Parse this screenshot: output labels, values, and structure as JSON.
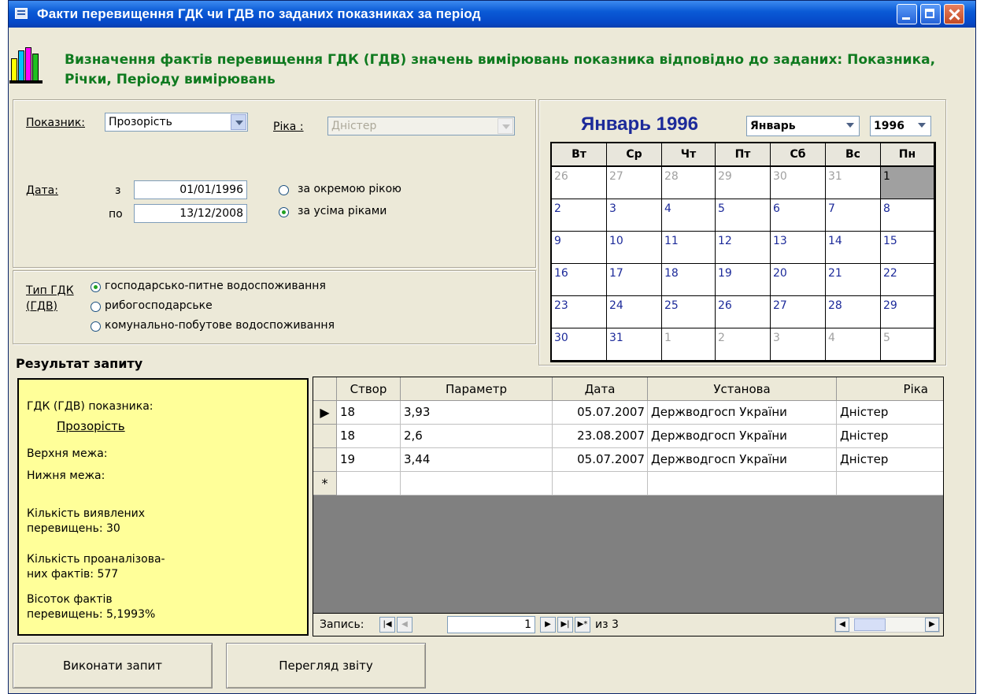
{
  "window": {
    "title": "Факти перевищення ГДК чи ГДВ по заданих показниках за період",
    "icon": "form-icon"
  },
  "header": {
    "icon": "bar-chart-icon",
    "text": "Визначення фактів перевищення ГДК (ГДВ) значень вимірювань показника відповідно до заданих: Показника, Річки, Періоду вимірювань"
  },
  "filters": {
    "indicator_label": "Показник:",
    "indicator_value": "Прозорість",
    "river_label": "Ріка :",
    "river_value": "Дністер",
    "date_label": "Дата:",
    "from_label": "з",
    "from_value": "01/01/1996",
    "to_label": "по",
    "to_value": "13/12/2008",
    "scope_options": [
      "за окремою рікою",
      "за усіма ріками"
    ],
    "scope_selected": 1
  },
  "gdk_type": {
    "label": "Тип ГДК (ГДВ)",
    "options": [
      "господарсько-питне водоспоживання",
      "рибогосподарське",
      "комунально-побутове водоспоживання"
    ],
    "selected": 0
  },
  "calendar": {
    "title": "Январь 1996",
    "month_select": "Январь",
    "year_select": "1996",
    "weekdays": [
      "Вт",
      "Ср",
      "Чт",
      "Пт",
      "Сб",
      "Вс",
      "Пн"
    ],
    "weeks": [
      [
        "26",
        "27",
        "28",
        "29",
        "30",
        "31",
        "1"
      ],
      [
        "2",
        "3",
        "4",
        "5",
        "6",
        "7",
        "8"
      ],
      [
        "9",
        "10",
        "11",
        "12",
        "13",
        "14",
        "15"
      ],
      [
        "16",
        "17",
        "18",
        "19",
        "20",
        "21",
        "22"
      ],
      [
        "23",
        "24",
        "25",
        "26",
        "27",
        "28",
        "29"
      ],
      [
        "30",
        "31",
        "1",
        "2",
        "3",
        "4",
        "5"
      ]
    ]
  },
  "result": {
    "heading": "Результат запиту",
    "gdk_label": "ГДК (ГДВ) показника:",
    "gdk_value": "Прозорість",
    "upper_label": "Верхня межа:",
    "lower_label": "Нижня межа:",
    "found_label": "Кількість виявлених",
    "found_text": "перевищень:  30",
    "analyzed_label": "Кількість проаналізова-",
    "analyzed_text": "них фактів: 577",
    "percent_label": "Вісоток фактів",
    "percent_text": "перевищень:  5,1993%"
  },
  "table": {
    "columns": [
      "Створ",
      "Параметр",
      "Дата",
      "Установа",
      "Ріка"
    ],
    "rows": [
      [
        "18",
        "3,93",
        "05.07.2007",
        "Держводгосп України",
        "Дністер"
      ],
      [
        "18",
        "2,6",
        "23.08.2007",
        "Держводгосп України",
        "Дністер"
      ],
      [
        "19",
        "3,44",
        "05.07.2007",
        "Держводгосп України",
        "Дністер"
      ]
    ],
    "new_row_marker": "*",
    "current_marker": "▶"
  },
  "navigator": {
    "record_label": "Запись:",
    "current": "1",
    "total_text": "из 3"
  },
  "buttons": {
    "run": "Виконати запит",
    "report": "Перегляд звіту"
  }
}
